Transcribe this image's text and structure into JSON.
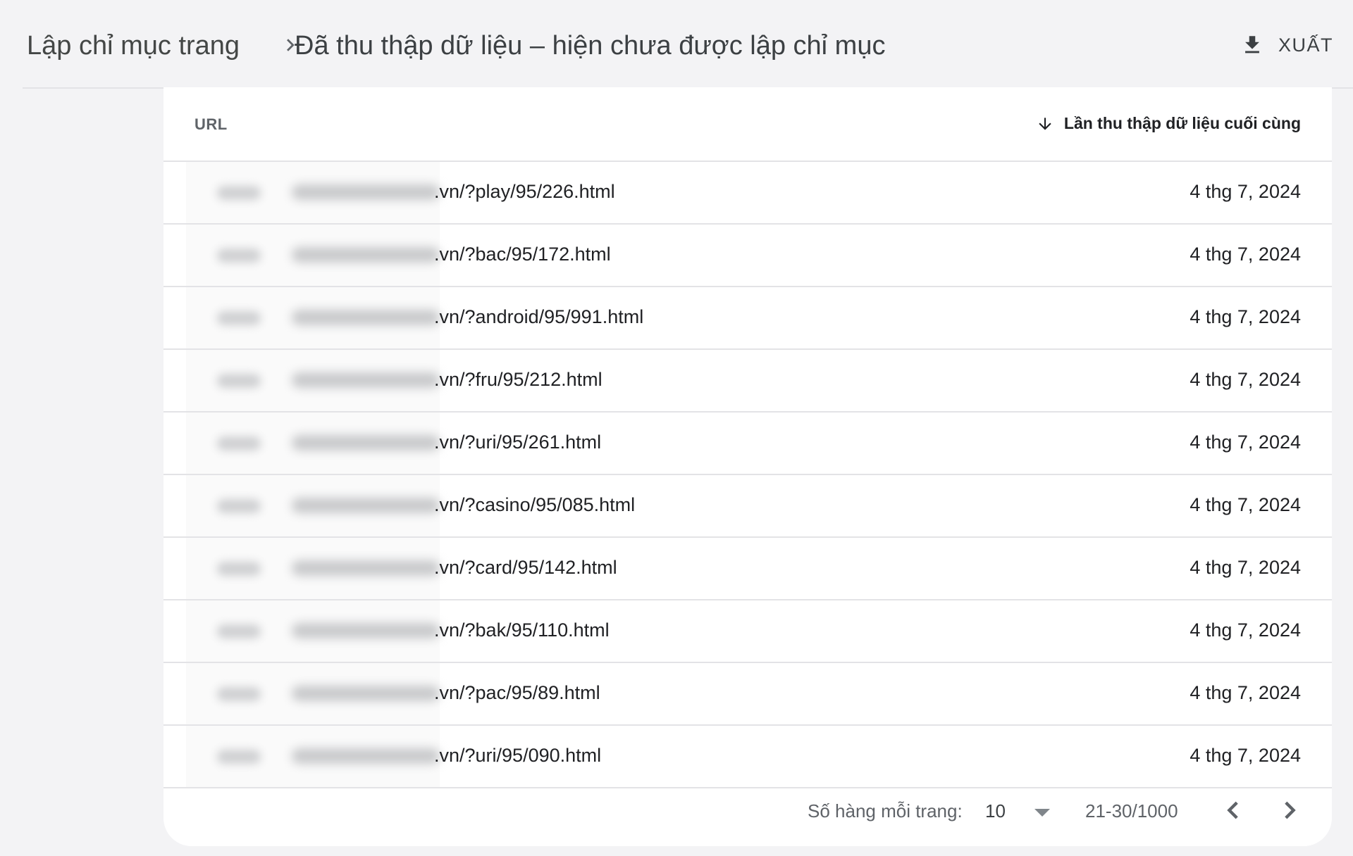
{
  "header": {
    "breadcrumb_root": "Lập chỉ mục trang",
    "breadcrumb_current": "Đã thu thập dữ liệu – hiện chưa được lập chỉ mục",
    "export_label": "XUẤT",
    "export_icon": "download-icon",
    "separator_icon": "chevron-right-icon"
  },
  "table": {
    "col_url": "URL",
    "col_date": "Lần thu thập dữ liệu cuối cùng",
    "sort_icon": "arrow-down-icon",
    "rows": [
      {
        "url": ".vn/?play/95/226.html",
        "date": "4 thg 7, 2024"
      },
      {
        "url": ".vn/?bac/95/172.html",
        "date": "4 thg 7, 2024"
      },
      {
        "url": ".vn/?android/95/991.html",
        "date": "4 thg 7, 2024"
      },
      {
        "url": ".vn/?fru/95/212.html",
        "date": "4 thg 7, 2024"
      },
      {
        "url": ".vn/?uri/95/261.html",
        "date": "4 thg 7, 2024"
      },
      {
        "url": ".vn/?casino/95/085.html",
        "date": "4 thg 7, 2024"
      },
      {
        "url": ".vn/?card/95/142.html",
        "date": "4 thg 7, 2024"
      },
      {
        "url": ".vn/?bak/95/110.html",
        "date": "4 thg 7, 2024"
      },
      {
        "url": ".vn/?pac/95/89.html",
        "date": "4 thg 7, 2024"
      },
      {
        "url": ".vn/?uri/95/090.html",
        "date": "4 thg 7, 2024"
      }
    ]
  },
  "pagination": {
    "rows_per_page_label": "Số hàng mỗi trang:",
    "rows_per_page_value": "10",
    "range": "21-30/1000",
    "prev_icon": "chevron-left-icon",
    "next_icon": "chevron-right-icon"
  },
  "colors": {
    "page_background": "#f3f3f5",
    "card_background": "#ffffff",
    "divider": "#e3e3e6"
  }
}
